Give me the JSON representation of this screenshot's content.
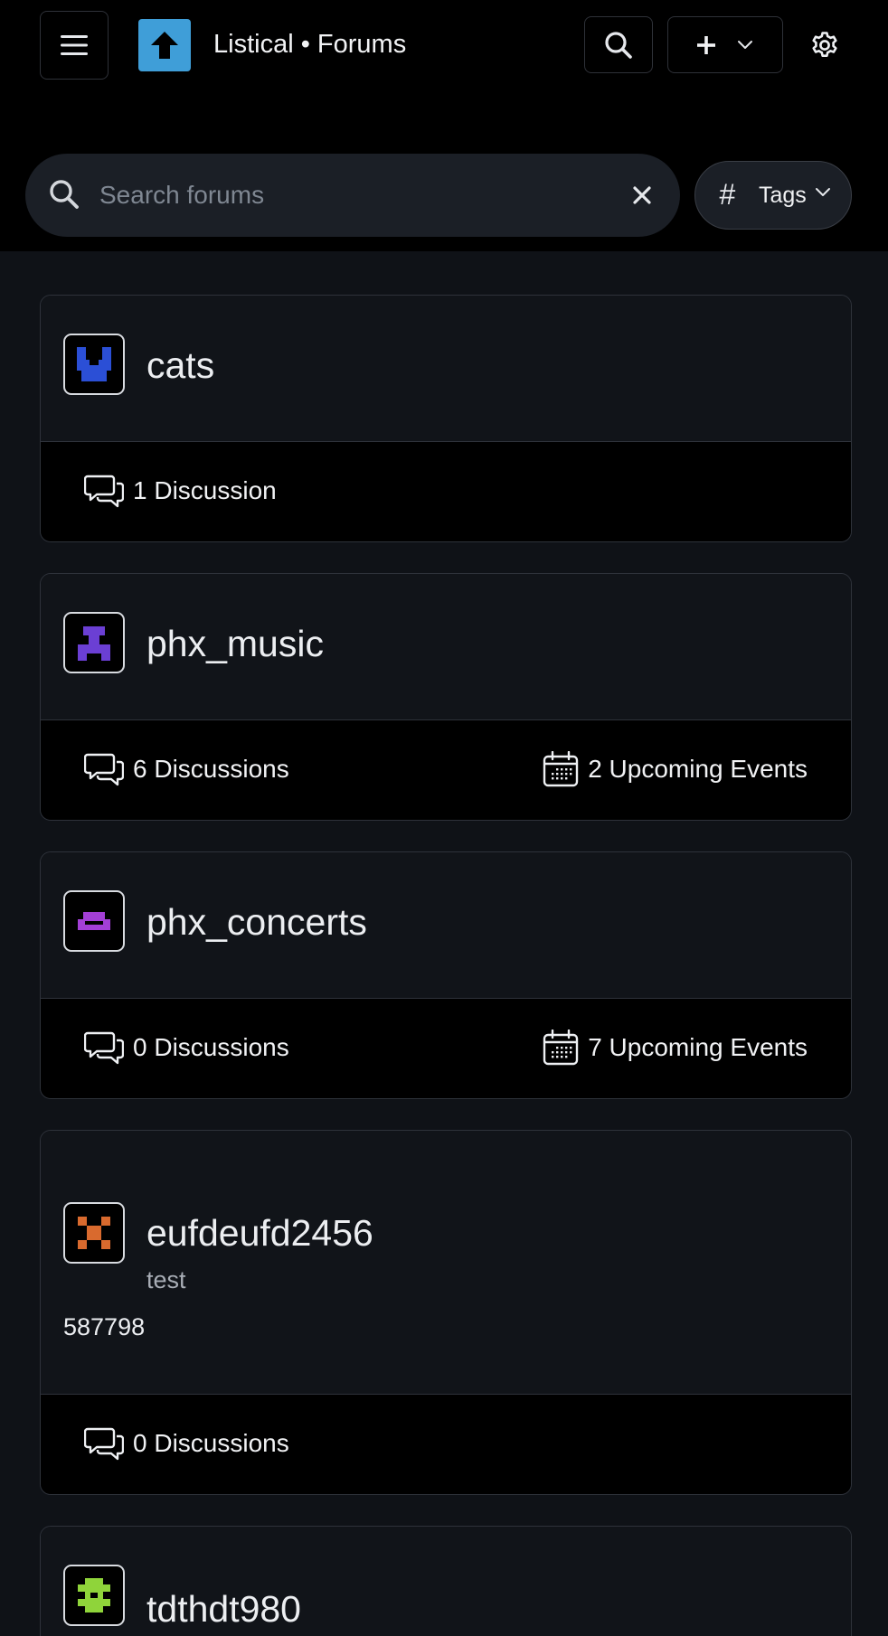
{
  "header": {
    "app_title": "Listical • Forums",
    "icons": {
      "menu": "hamburger-menu-icon",
      "logo": "up-arrow-logo-icon",
      "search": "search-icon",
      "create": "plus-icon",
      "create_menu": "chevron-down-icon",
      "settings": "gear-icon"
    }
  },
  "search": {
    "placeholder": "Search forums",
    "value": "",
    "clear_icon": "close-icon",
    "tags_label": "Tags",
    "tags_icon": "hash-icon"
  },
  "forums": [
    {
      "name": "cats",
      "avatar_color": "#2b4fd6",
      "avatar_icon": "pixel-avatar-icon",
      "discussions": "1 Discussion",
      "events": ""
    },
    {
      "name": "phx_music",
      "avatar_color": "#6b3fd4",
      "avatar_icon": "pixel-avatar-icon",
      "discussions": "6 Discussions",
      "events": "2 Upcoming Events"
    },
    {
      "name": "phx_concerts",
      "avatar_color": "#a33fd6",
      "avatar_icon": "pixel-avatar-icon",
      "discussions": "0 Discussions",
      "events": "7 Upcoming Events"
    },
    {
      "name": "eufdeufd2456",
      "description": "test",
      "extra": "587798",
      "avatar_color": "#d96a2e",
      "avatar_icon": "pixel-avatar-icon",
      "discussions": "0 Discussions",
      "events": ""
    },
    {
      "name": "tdthdt980",
      "avatar_color": "#8fd43a",
      "avatar_icon": "pixel-avatar-icon"
    }
  ],
  "colors": {
    "background": "#000000",
    "card": "#111419",
    "logo": "#3f9ed8",
    "border": "#2e323a"
  }
}
